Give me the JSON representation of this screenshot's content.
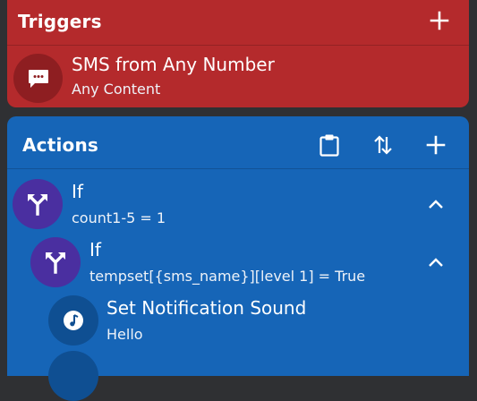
{
  "triggers": {
    "title": "Triggers",
    "items": [
      {
        "title": "SMS from Any Number",
        "subtitle": "Any Content",
        "icon": "sms-icon"
      }
    ]
  },
  "actions": {
    "title": "Actions",
    "items": [
      {
        "title": "If",
        "subtitle": "count1-5 = 1",
        "icon": "branch-icon",
        "expander": "chevron-up-icon"
      },
      {
        "title": "If",
        "subtitle": "tempset[{sms_name}][level 1] = True",
        "icon": "branch-icon",
        "expander": "chevron-up-icon"
      },
      {
        "title": "Set Notification Sound",
        "subtitle": "Hello",
        "icon": "music-note-icon"
      }
    ]
  },
  "colors": {
    "triggers_bg": "#b42a2c",
    "actions_bg": "#1665b7",
    "branch_circle": "#4a2fa0",
    "sms_circle": "#8e1e21",
    "sound_circle": "#0f4f92"
  }
}
